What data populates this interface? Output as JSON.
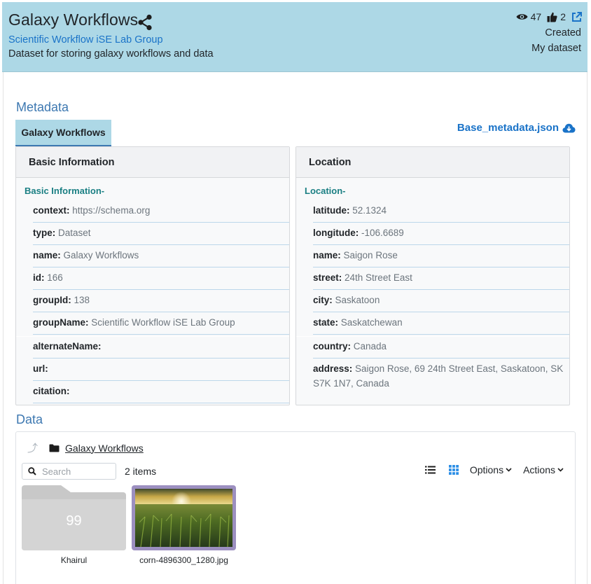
{
  "header": {
    "title": "Galaxy Workflows",
    "group": "Scientific Workflow iSE Lab Group",
    "description": "Dataset for storing galaxy workflows and data",
    "views": "47",
    "likes": "2",
    "created_label": "Created",
    "owner_label": "My dataset"
  },
  "metadata": {
    "section_title": "Metadata",
    "tab": "Galaxy Workflows",
    "download_label": "Base_metadata.json",
    "basic": {
      "header": "Basic Information",
      "sub": "Basic Information-",
      "fields": [
        {
          "k": "context:",
          "v": "https://schema.org"
        },
        {
          "k": "type:",
          "v": "Dataset"
        },
        {
          "k": "name:",
          "v": "Galaxy Workflows"
        },
        {
          "k": "id:",
          "v": "166"
        },
        {
          "k": "groupId:",
          "v": "138"
        },
        {
          "k": "groupName:",
          "v": "Scientific Workflow iSE Lab Group"
        },
        {
          "k": "alternateName:",
          "v": ""
        },
        {
          "k": "url:",
          "v": ""
        },
        {
          "k": "citation:",
          "v": ""
        }
      ]
    },
    "location": {
      "header": "Location",
      "sub": "Location-",
      "fields": [
        {
          "k": "latitude:",
          "v": "52.1324"
        },
        {
          "k": "longitude:",
          "v": "-106.6689"
        },
        {
          "k": "name:",
          "v": "Saigon Rose"
        },
        {
          "k": "street:",
          "v": "24th Street East"
        },
        {
          "k": "city:",
          "v": "Saskatoon"
        },
        {
          "k": "state:",
          "v": "Saskatchewan"
        },
        {
          "k": "country:",
          "v": "Canada"
        },
        {
          "k": "address:",
          "v": "Saigon Rose, 69 24th Street East, Saskatoon, SK S7K 1N7, Canada"
        }
      ]
    }
  },
  "data": {
    "section_title": "Data",
    "breadcrumb": "Galaxy Workflows",
    "search_placeholder": "Search",
    "items_count": "2 items",
    "options_label": "Options",
    "actions_label": "Actions",
    "files": [
      {
        "name": "Khairul",
        "badge": "99"
      },
      {
        "name": "corn-4896300_1280.jpg"
      }
    ]
  },
  "colors": {
    "header_bg": "#add8e6",
    "link": "#1a73c8",
    "section": "#3d78b1",
    "teal": "#1a7f83"
  }
}
